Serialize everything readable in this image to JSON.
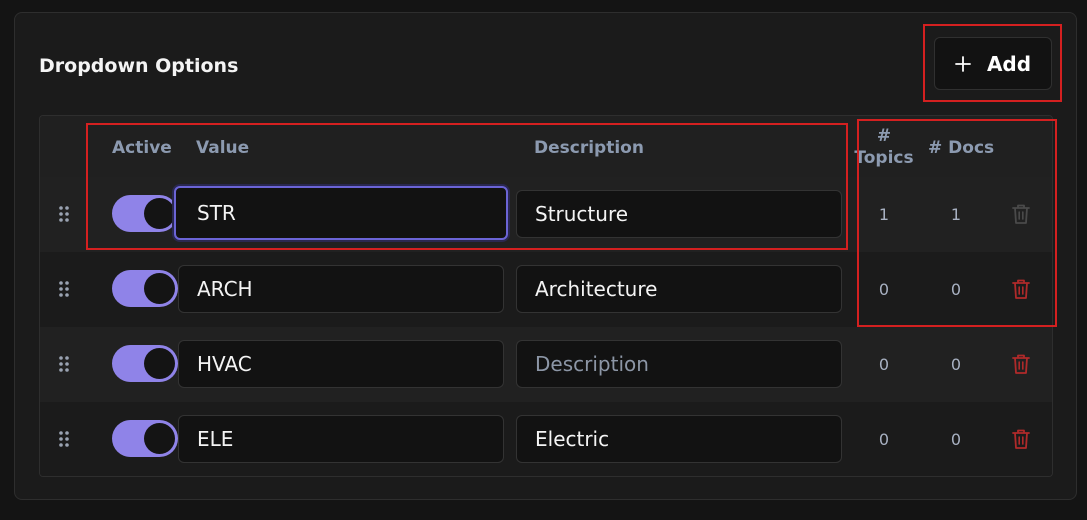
{
  "header": {
    "title": "Dropdown Options",
    "add_label": "Add"
  },
  "columns": {
    "active": "Active",
    "value": "Value",
    "description": "Description",
    "topics_line1": "#",
    "topics_line2": "Topics",
    "docs": "# Docs"
  },
  "description_placeholder": "Description",
  "colors": {
    "toggle_on": "#8f83e8",
    "focus_ring": "#6b64d6",
    "delete_active": "#b02a2a",
    "delete_disabled": "#4a4a4a",
    "annotation": "#d42020"
  },
  "rows": [
    {
      "active": true,
      "value": "STR",
      "description": "Structure",
      "topics": "1",
      "docs": "1",
      "delete_enabled": false,
      "focused": true
    },
    {
      "active": true,
      "value": "ARCH",
      "description": "Architecture",
      "topics": "0",
      "docs": "0",
      "delete_enabled": true,
      "focused": false
    },
    {
      "active": true,
      "value": "HVAC",
      "description": "",
      "topics": "0",
      "docs": "0",
      "delete_enabled": true,
      "focused": false
    },
    {
      "active": true,
      "value": "ELE",
      "description": "Electric",
      "topics": "0",
      "docs": "0",
      "delete_enabled": true,
      "focused": false
    }
  ]
}
